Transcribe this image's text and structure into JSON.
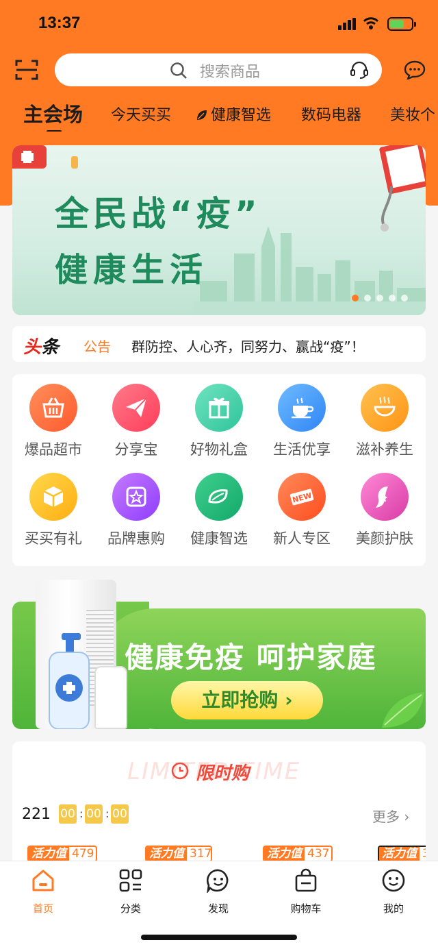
{
  "status": {
    "time": "13:37"
  },
  "search": {
    "placeholder": "搜索商品"
  },
  "icons": {
    "scan": "scan-icon",
    "search": "search-icon",
    "service": "headset-icon",
    "message": "chat-bubble-icon"
  },
  "tabs": [
    "主会场",
    "今天买买",
    "健康智选",
    "数码电器",
    "美妆个"
  ],
  "banner": {
    "line1": "全民战“疫”",
    "line2": "健康生活",
    "slides": 5,
    "active_slide": 1
  },
  "notice": {
    "logo_a": "头",
    "logo_b": "条",
    "tag": "公告",
    "text": "群防控、人心齐，同努力、赢战“疫”！"
  },
  "categories": [
    {
      "label": "爆品超市",
      "icon": "basket-icon",
      "color": "#ff6a3d"
    },
    {
      "label": "分享宝",
      "icon": "paper-plane-icon",
      "color": "#ff4d6d"
    },
    {
      "label": "好物礼盒",
      "icon": "gift-icon",
      "color": "#3fd0a8"
    },
    {
      "label": "生活优享",
      "icon": "coffee-cup-icon",
      "color": "#3d9bff"
    },
    {
      "label": "滋补养生",
      "icon": "bowl-icon",
      "color": "#ffa326"
    },
    {
      "label": "买买有礼",
      "icon": "box-icon",
      "color": "#ffbf1f"
    },
    {
      "label": "品牌惠购",
      "icon": "star-badge-icon",
      "color": "#a64dff"
    },
    {
      "label": "健康智选",
      "icon": "leaf-icon",
      "color": "#1fb87a"
    },
    {
      "label": "新人专区",
      "icon": "new-badge-icon",
      "color": "#ff5a2e"
    },
    {
      "label": "美颜护肤",
      "icon": "woman-profile-icon",
      "color": "#e94fb2"
    }
  ],
  "promo": {
    "headline": "健康免疫 呵护家庭",
    "button": "立即抢购 ›"
  },
  "flash": {
    "bg_text": "LIMITED TIME",
    "title": "限时购",
    "count": "221",
    "hh": "00",
    "mm": "00",
    "ss": "00",
    "more": "更多",
    "tag_label": "活力值",
    "values": [
      "479",
      "317",
      "437",
      "3"
    ]
  },
  "tabbar": [
    {
      "label": "首页",
      "icon": "home-icon",
      "active": true
    },
    {
      "label": "分类",
      "icon": "category-grid-icon",
      "active": false
    },
    {
      "label": "发现",
      "icon": "discover-face-icon",
      "active": false
    },
    {
      "label": "购物车",
      "icon": "shopping-bag-icon",
      "active": false
    },
    {
      "label": "我的",
      "icon": "profile-smile-icon",
      "active": false
    }
  ],
  "colors": {
    "brand": "#ff7a22",
    "banner_text": "#1f8a5b",
    "flash_red": "#ef4a3c"
  }
}
